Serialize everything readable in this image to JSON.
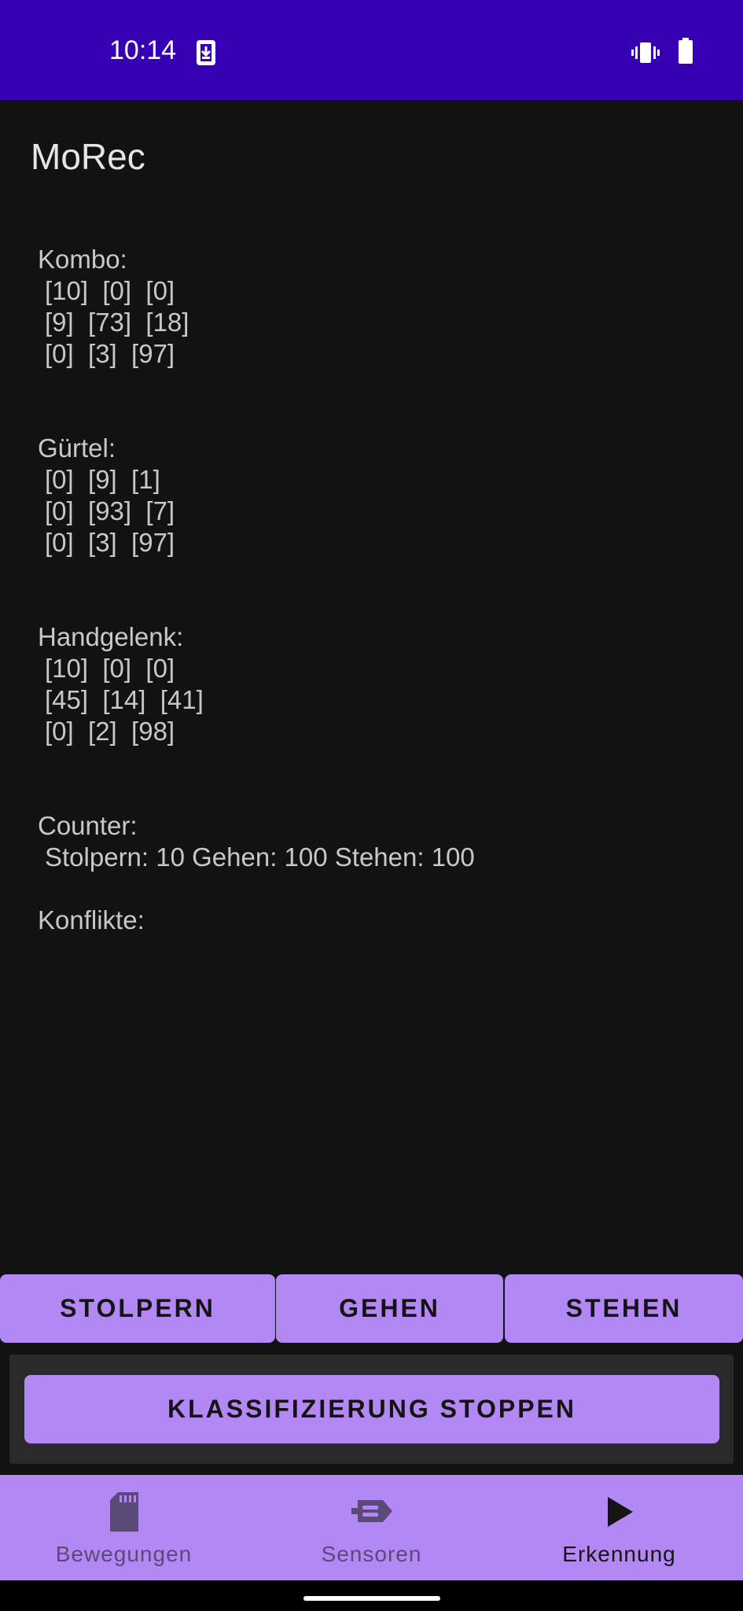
{
  "status_bar": {
    "time": "10:14",
    "icons": [
      "download-icon",
      "vibrate-icon",
      "battery-icon"
    ]
  },
  "app_bar": {
    "title": "MoRec"
  },
  "sections": {
    "kombo": {
      "label": "Kombo:",
      "rows": [
        "[10]  [0]  [0]",
        "[9]  [73]  [18]",
        "[0]  [3]  [97]"
      ]
    },
    "guertel": {
      "label": "Gürtel:",
      "rows": [
        "[0]  [9]  [1]",
        "[0]  [93]  [7]",
        "[0]  [3]  [97]"
      ]
    },
    "handgelenk": {
      "label": "Handgelenk:",
      "rows": [
        "[10]  [0]  [0]",
        "[45]  [14]  [41]",
        "[0]  [2]  [98]"
      ]
    },
    "counter": {
      "label": "Counter:",
      "value": "Stolpern: 10 Gehen: 100 Stehen: 100"
    },
    "konflikte": {
      "label": "Konflikte:"
    }
  },
  "class_buttons": {
    "stolpern": "STOLPERN",
    "gehen": "GEHEN",
    "stehen": "STEHEN"
  },
  "stop_button": "KLASSIFIZIERUNG STOPPEN",
  "nav": {
    "items": [
      {
        "label": "Bewegungen",
        "icon": "sd-card-icon",
        "active": false
      },
      {
        "label": "Sensoren",
        "icon": "sensor-icon",
        "active": false
      },
      {
        "label": "Erkennung",
        "icon": "play-icon",
        "active": true
      }
    ]
  },
  "colors": {
    "status_bar": "#3700b3",
    "accent": "#b388f5",
    "background": "#121212"
  }
}
